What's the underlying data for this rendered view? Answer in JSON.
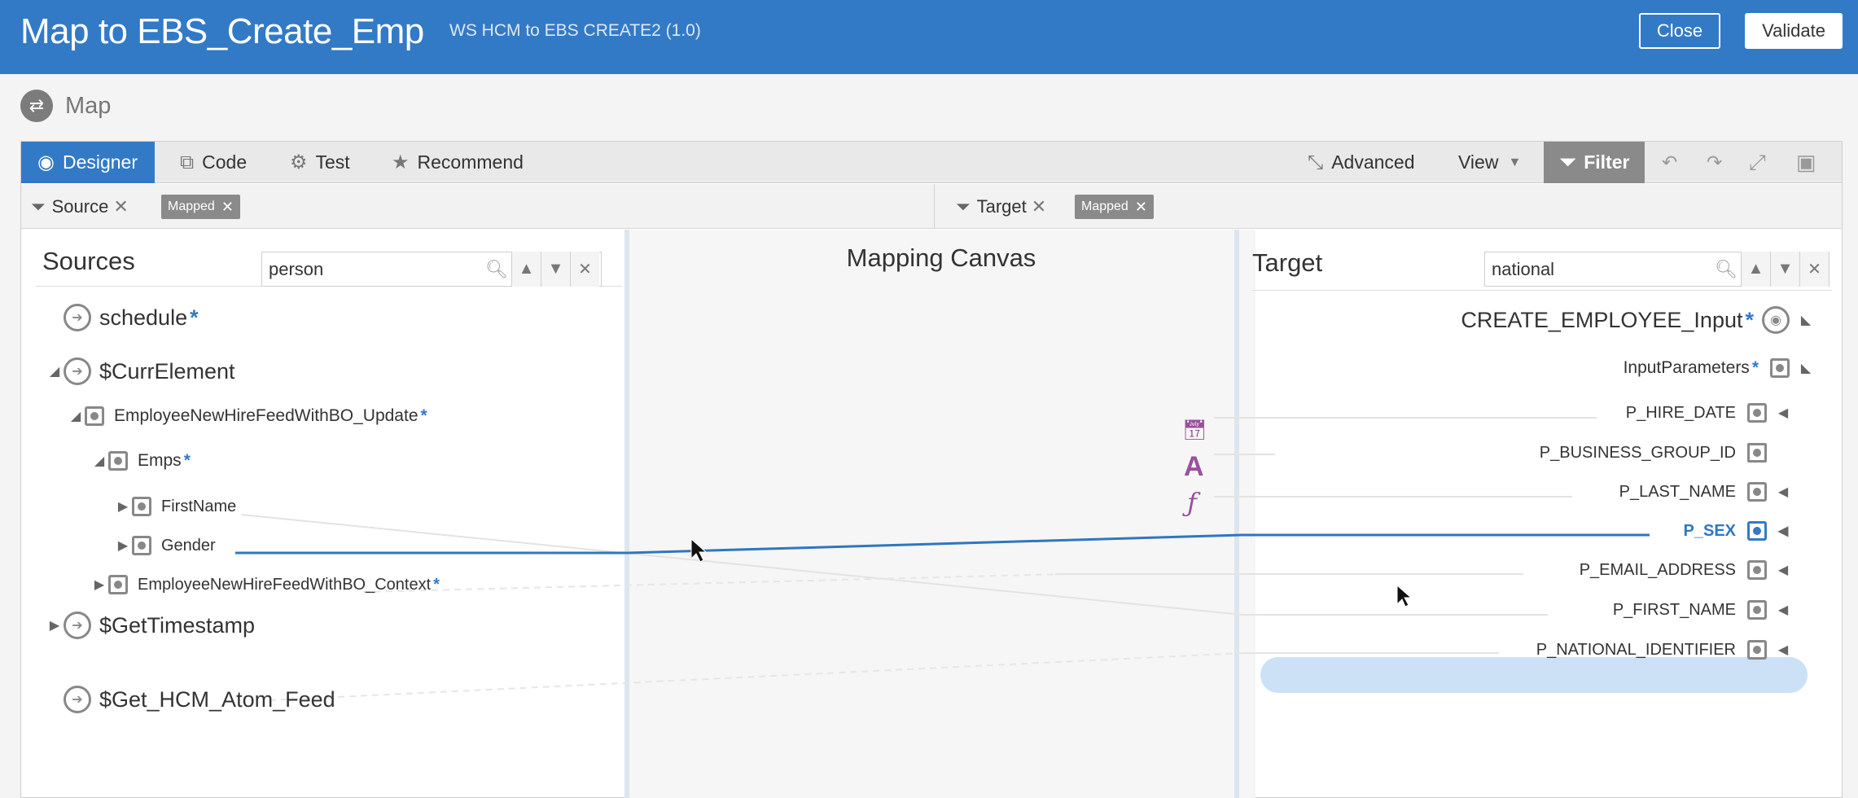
{
  "header": {
    "title": "Map to EBS_Create_Emp",
    "subtitle": "WS HCM to EBS CREATE2 (1.0)",
    "close_label": "Close",
    "validate_label": "Validate"
  },
  "map_label": "Map",
  "toolbar": {
    "designer": "Designer",
    "code": "Code",
    "test": "Test",
    "recommend": "Recommend",
    "advanced": "Advanced",
    "view": "View",
    "filter": "Filter"
  },
  "filterbar": {
    "source_label": "Source",
    "source_chip": "Mapped",
    "target_label": "Target",
    "target_chip": "Mapped"
  },
  "sources": {
    "title": "Sources",
    "search_value": "person",
    "items": [
      {
        "label": "schedule",
        "starred": true
      },
      {
        "label": "$CurrElement"
      },
      {
        "label": "EmployeeNewHireFeedWithBO_Update",
        "starred": true
      },
      {
        "label": "Emps",
        "starred": true
      },
      {
        "label": "FirstName"
      },
      {
        "label": "Gender"
      },
      {
        "label": "EmployeeNewHireFeedWithBO_Context",
        "starred": true
      },
      {
        "label": "$GetTimestamp"
      },
      {
        "label": "$Get_HCM_Atom_Feed"
      }
    ]
  },
  "canvas": {
    "title": "Mapping Canvas"
  },
  "target": {
    "title": "Target",
    "search_value": "national",
    "items": [
      {
        "label": "CREATE_EMPLOYEE_Input",
        "starred": true
      },
      {
        "label": "InputParameters",
        "starred": true
      },
      {
        "label": "P_HIRE_DATE"
      },
      {
        "label": "P_BUSINESS_GROUP_ID"
      },
      {
        "label": "P_LAST_NAME"
      },
      {
        "label": "P_SEX",
        "selected": true
      },
      {
        "label": "P_EMAIL_ADDRESS"
      },
      {
        "label": "P_FIRST_NAME"
      },
      {
        "label": "P_NATIONAL_IDENTIFIER"
      }
    ]
  },
  "colors": {
    "header_blue": "#337ac6",
    "function_purple": "#9b4f9e",
    "mapping_line": "#2f76c0"
  }
}
